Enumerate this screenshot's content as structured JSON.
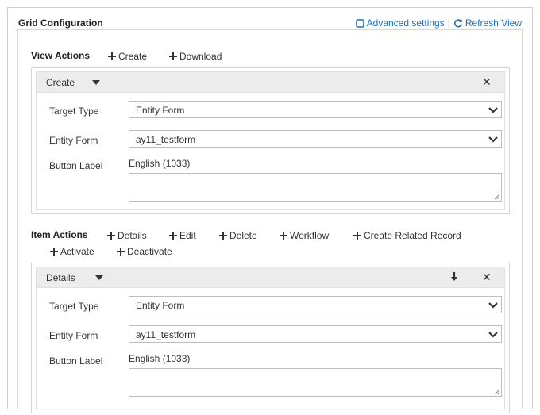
{
  "header": {
    "title": "Grid Configuration",
    "advanced_settings_label": "Advanced settings",
    "separator": "|",
    "refresh_view_label": "Refresh View"
  },
  "view_actions": {
    "label": "View Actions",
    "actions": [
      "Create",
      "Download"
    ],
    "panel": {
      "title": "Create",
      "target_type_label": "Target Type",
      "target_type_value": "Entity Form",
      "entity_form_label": "Entity Form",
      "entity_form_value": "ay11_testform",
      "button_label_label": "Button Label",
      "language": "English (1033)",
      "button_label_value": ""
    }
  },
  "item_actions": {
    "label": "Item Actions",
    "actions": [
      "Details",
      "Edit",
      "Delete",
      "Workflow",
      "Create Related Record",
      "Activate",
      "Deactivate"
    ],
    "panel": {
      "title": "Details",
      "target_type_label": "Target Type",
      "target_type_value": "Entity Form",
      "entity_form_label": "Entity Form",
      "entity_form_value": "ay11_testform",
      "button_label_label": "Button Label",
      "language": "English (1033)",
      "button_label_value": ""
    }
  },
  "colors": {
    "link": "#1e6fb7",
    "panel_header": "#ececec",
    "border": "#d4d4d4",
    "text": "#333333"
  }
}
